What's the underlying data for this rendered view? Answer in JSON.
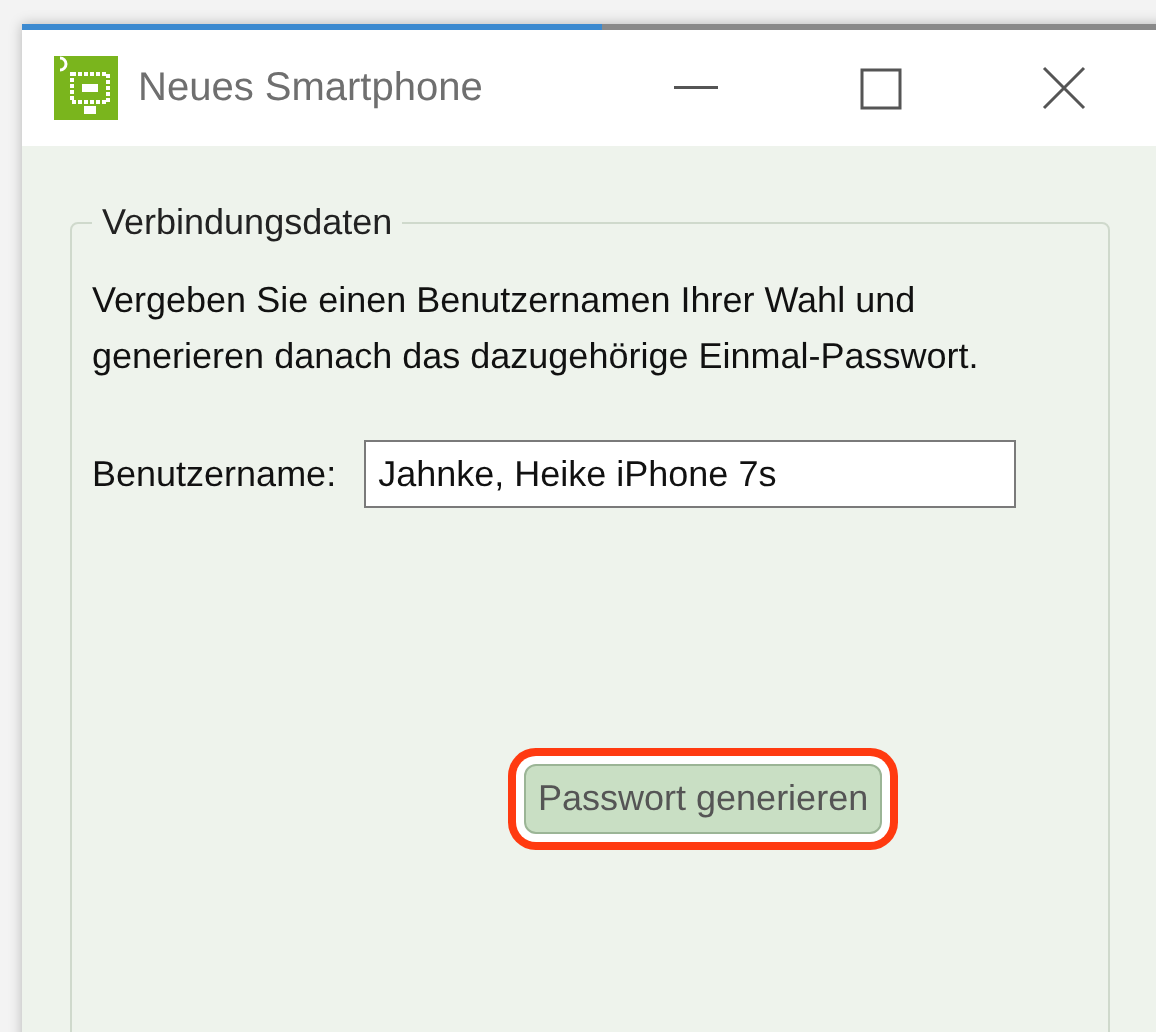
{
  "window": {
    "title": "Neues Smartphone"
  },
  "group": {
    "legend": "Verbindungsdaten",
    "description": "Vergeben Sie einen Benutzernamen Ihrer Wahl und generieren danach das dazugehörige Einmal-Passwort.",
    "username_label": "Benutzername:",
    "username_value": "Jahnke, Heike iPhone 7s",
    "button": {
      "label": "Passwort generieren",
      "highlighted": true
    }
  }
}
